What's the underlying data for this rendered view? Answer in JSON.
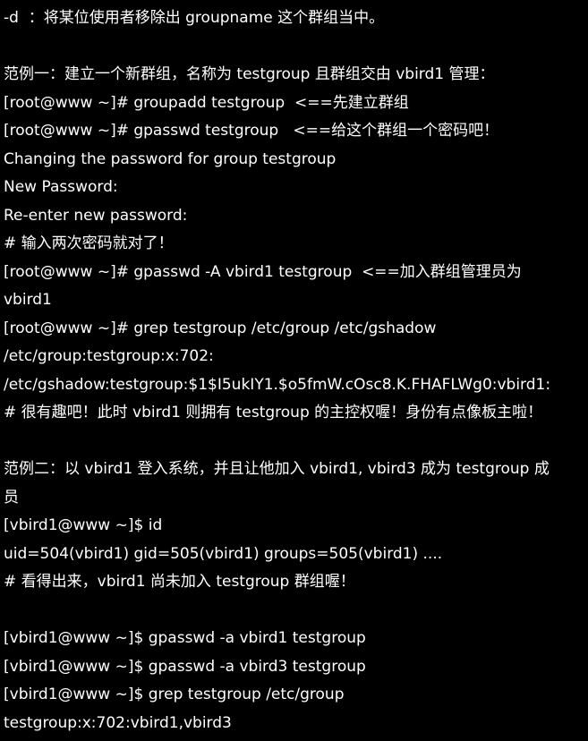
{
  "terminal": {
    "lines": [
      "-d  ：将某位使用者移除出 groupname 这个群组当中。",
      "",
      "范例一：建立一个新群组，名称为 testgroup 且群组交由 vbird1 管理：",
      "[root@www ~]# groupadd testgroup  <==先建立群组",
      "[root@www ~]# gpasswd testgroup   <==给这个群组一个密码吧！",
      "Changing the password for group testgroup",
      "New Password:",
      "Re-enter new password:",
      "# 输入两次密码就对了！",
      "[root@www ~]# gpasswd -A vbird1 testgroup  <==加入群组管理员为",
      "vbird1",
      "[root@www ~]# grep testgroup /etc/group /etc/gshadow",
      "/etc/group:testgroup:x:702:",
      "/etc/gshadow:testgroup:$1$I5ukIY1.$o5fmW.cOsc8.K.FHAFLWg0:vbird1:",
      "# 很有趣吧！此时 vbird1 则拥有 testgroup 的主控权喔！身份有点像板主啦！",
      "",
      "范例二：以 vbird1 登入系统，并且让他加入 vbird1, vbird3 成为 testgroup 成",
      "员",
      "[vbird1@www ~]$ id",
      "uid=504(vbird1) gid=505(vbird1) groups=505(vbird1) ....",
      "# 看得出来，vbird1 尚未加入 testgroup 群组喔！",
      "",
      "[vbird1@www ~]$ gpasswd -a vbird1 testgroup",
      "[vbird1@www ~]$ gpasswd -a vbird3 testgroup",
      "[vbird1@www ~]$ grep testgroup /etc/group",
      "testgroup:x:702:vbird1,vbird3"
    ]
  }
}
